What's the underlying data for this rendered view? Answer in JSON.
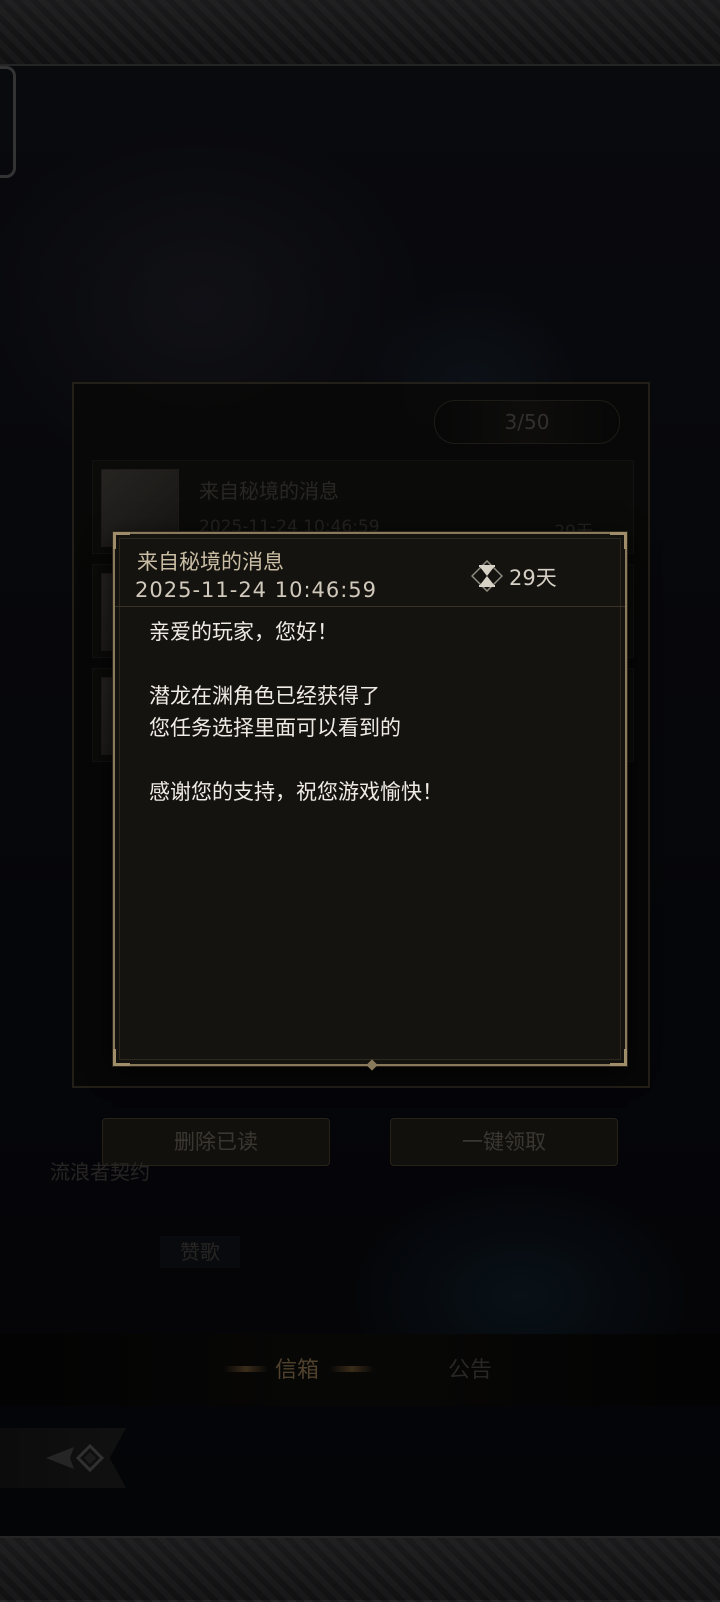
{
  "background": {
    "mail_count": "3/50",
    "mail_items": [
      {
        "title": "来自秘境的消息",
        "date": "2025-11-24 10:46:59",
        "expire": "29天"
      }
    ],
    "buttons": {
      "delete_read": "删除已读",
      "claim_all": "一键领取"
    },
    "side_labels": {
      "wanderer_contract": "流浪者契约",
      "hymn": "赞歌"
    },
    "tabs": {
      "mail": "信箱",
      "notice": "公告"
    }
  },
  "dialog": {
    "title": "来自秘境的消息",
    "date": "2025-11-24  10:46:59",
    "expire_icon": "hourglass-icon",
    "expire_text": "29天",
    "body": {
      "greeting": "亲爱的玩家，您好！",
      "line1": "潜龙在渊角色已经获得了",
      "line2": "您任务选择里面可以看到的",
      "closing": "感谢您的支持，祝您游戏愉快！"
    }
  },
  "colors": {
    "dialog_border": "#8a7a5c",
    "dialog_bg": "#151310",
    "title_text": "#c9bda3",
    "body_text": "#efebe4",
    "active_tab": "#7a6544"
  }
}
